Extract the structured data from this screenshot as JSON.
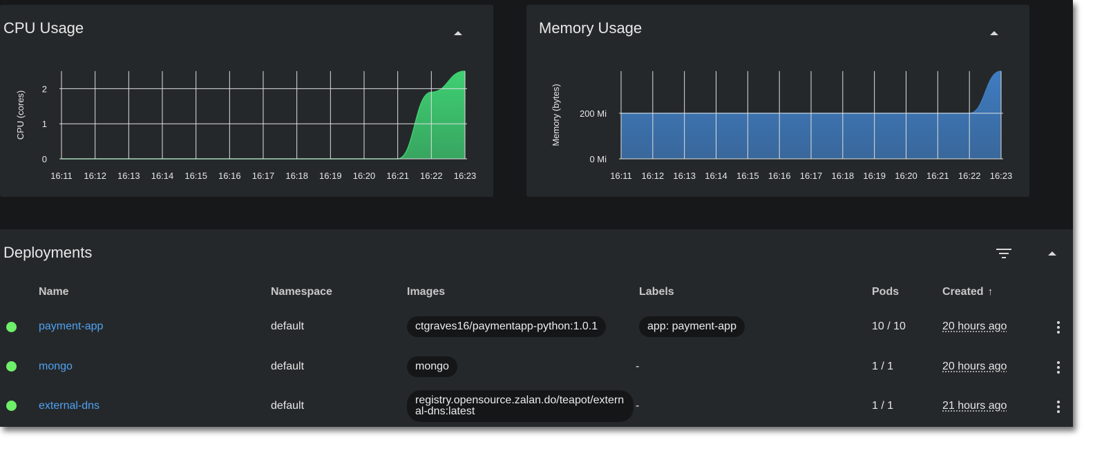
{
  "cpu": {
    "title": "CPU Usage",
    "chart_data": {
      "type": "area",
      "title": "CPU Usage",
      "ylabel": "CPU (cores)",
      "xlabel": "",
      "x": [
        "16:11",
        "16:12",
        "16:13",
        "16:14",
        "16:15",
        "16:16",
        "16:17",
        "16:18",
        "16:19",
        "16:20",
        "16:21",
        "16:22",
        "16:23"
      ],
      "series": [
        {
          "values": [
            0,
            0,
            0,
            0,
            0,
            0,
            0,
            0,
            0,
            0,
            0,
            1.9,
            2.5
          ]
        }
      ],
      "yticks": [
        0,
        1,
        2
      ],
      "ytick_labels": [
        "0",
        "1",
        "2"
      ],
      "ylim": [
        0,
        2.5
      ],
      "grid": true,
      "color": "#3ecf72"
    }
  },
  "memory": {
    "title": "Memory Usage",
    "chart_data": {
      "type": "area",
      "title": "Memory Usage",
      "ylabel": "Memory (bytes)",
      "xlabel": "",
      "x": [
        "16:11",
        "16:12",
        "16:13",
        "16:14",
        "16:15",
        "16:16",
        "16:17",
        "16:18",
        "16:19",
        "16:20",
        "16:21",
        "16:22",
        "16:23"
      ],
      "series": [
        {
          "values": [
            200,
            200,
            200,
            200,
            200,
            200,
            200,
            200,
            200,
            200,
            200,
            200,
            385
          ]
        }
      ],
      "yticks": [
        0,
        200
      ],
      "ytick_labels": [
        "0 Mi",
        "200 Mi"
      ],
      "ylim": [
        0,
        385
      ],
      "grid": true,
      "color": "#3f7cc0"
    }
  },
  "deployments": {
    "title": "Deployments",
    "columns": {
      "name": "Name",
      "namespace": "Namespace",
      "images": "Images",
      "labels": "Labels",
      "pods": "Pods",
      "created": "Created"
    },
    "sort_arrow": "↑",
    "rows": [
      {
        "name": "payment-app",
        "namespace": "default",
        "image": "ctgraves16/paymentapp-python:1.0.1",
        "label": "app: payment-app",
        "pods": "10 / 10",
        "created": "20 hours ago"
      },
      {
        "name": "mongo",
        "namespace": "default",
        "image": "mongo",
        "label": "-",
        "pods": "1 / 1",
        "created": "20 hours ago"
      },
      {
        "name": "external-dns",
        "namespace": "default",
        "image": "registry.opensource.zalan.do/teapot/external-dns:latest",
        "label": "-",
        "pods": "1 / 1",
        "created": "21 hours ago"
      }
    ],
    "status_color": "#6ef06a",
    "link_color": "#4ea3f4"
  },
  "icons": {
    "collapse": "chevron-up-icon",
    "filter": "filter-icon",
    "row_menu": "more-vertical-icon"
  }
}
